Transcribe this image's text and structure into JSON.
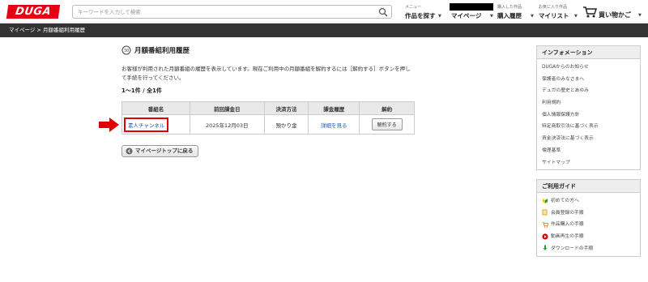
{
  "header": {
    "logo": "DUGA",
    "search": {
      "placeholder": "キーワードを入力して検索"
    },
    "nav": [
      {
        "small": "メニュー",
        "label": "作品を探す"
      },
      {
        "small": "",
        "label": "マイページ"
      },
      {
        "small": "購入した作品",
        "label": "購入履歴"
      },
      {
        "small": "お気に入り作品",
        "label": "マイリスト"
      }
    ],
    "cart": "買い物かご"
  },
  "breadcrumb": "マイページ > 月額番組利用履歴",
  "page": {
    "title": "月額番組利用履歴",
    "description": "お客様が利用された月額番組の履歴を表示しています。現在ご利用中の月額番組を解約するには［解約する］ボタンを押して手続を行ってください。",
    "count": "1～1件 / 全1件"
  },
  "table": {
    "headers": [
      "番組名",
      "前回課金日",
      "決済方法",
      "課金履歴",
      "解約"
    ],
    "rows": [
      {
        "name": "素人チャンネル",
        "date": "2025年12月03日",
        "method": "預かり金",
        "history": "詳細を見る",
        "cancel": "解約する"
      }
    ]
  },
  "back_button": "マイページトップに戻る",
  "sidebar": {
    "info": {
      "title": "インフォメーション",
      "items": [
        "DUGAからのお知らせ",
        "保護者のみなさまへ",
        "デュガの歴史とあゆみ",
        "利用規約",
        "個人情報保護方針",
        "特定商取引法に基づく表示",
        "資金決済法に基づく表示",
        "倫理基準",
        "サイトマップ"
      ]
    },
    "guide": {
      "title": "ご利用ガイド",
      "items": [
        {
          "label": "初めての方へ",
          "icon": "beginner-icon"
        },
        {
          "label": "会員登録の手順",
          "icon": "memo-icon"
        },
        {
          "label": "作品購入の手順",
          "icon": "cart-icon"
        },
        {
          "label": "動画再生の手順",
          "icon": "play-icon"
        },
        {
          "label": "ダウンロードの手順",
          "icon": "download-icon"
        }
      ]
    }
  },
  "colors": {
    "brand": "#e60012",
    "link": "#1a55b7",
    "highlight": "#e10000",
    "breadcrumb_bg": "#333333"
  }
}
